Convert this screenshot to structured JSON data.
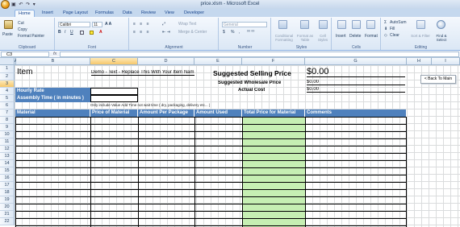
{
  "window": {
    "title": "price.xlsm - Microsoft Excel",
    "quick_access": "▣ ↶ ↷ ▾"
  },
  "ribbon_tabs": [
    "Home",
    "Insert",
    "Page Layout",
    "Formulas",
    "Data",
    "Review",
    "View",
    "Developer"
  ],
  "ribbon": {
    "clipboard": {
      "paste": "Paste",
      "cut": "Cut",
      "copy": "Copy",
      "format_painter": "Format Painter",
      "label": "Clipboard"
    },
    "font": {
      "name": "Calibri",
      "size": "11",
      "label": "Font"
    },
    "alignment": {
      "wrap": "Wrap Text",
      "merge": "Merge & Center",
      "label": "Alignment"
    },
    "number": {
      "format": "General",
      "currency": "$",
      "percent": "%",
      "comma": ",",
      "label": "Number"
    },
    "styles": {
      "conditional": "Conditional Formatting",
      "as_table": "Format as Table",
      "cell_styles": "Cell Styles",
      "label": "Styles"
    },
    "cells": {
      "insert": "Insert",
      "delete": "Delete",
      "format": "Format",
      "label": "Cells"
    },
    "editing": {
      "autosum": "AutoSum",
      "fill": "Fill",
      "clear": "Clear",
      "sort": "Sort & Filter",
      "find": "Find & Select",
      "label": "Editing"
    }
  },
  "formula_bar": {
    "name_box": "C3",
    "fx": "fx",
    "formula": ""
  },
  "columns": [
    "A",
    "B",
    "C",
    "D",
    "E",
    "F",
    "G",
    "H",
    "I"
  ],
  "rows": [
    "1",
    "2",
    "3",
    "4",
    "5",
    "6",
    "7",
    "8",
    "9",
    "10",
    "11",
    "12",
    "13",
    "14",
    "15",
    "16",
    "17",
    "18",
    "19",
    "20",
    "21",
    "22"
  ],
  "sheet": {
    "item_label": "Item",
    "item_value": "Demo - Text - Replace This With Your Item Nam",
    "ssp_label": "Suggested Selling Price",
    "ssp_value": "$0.00",
    "swp_label": "Suggested Wholesale Price",
    "swp_value": "$0.00",
    "ac_label": "Actual Cost",
    "ac_value": "$0.00",
    "back_button": "< Back To Main",
    "hourly_rate": "Hourly Rate",
    "assembly_time": "Assembly Time ( in minutes )",
    "note": "Only include Value Add Time not wait time ( dry, packaging, delivery etc... )",
    "table_headers": [
      "Material",
      "Price of Material",
      "Amount Per Package",
      "Amount Used",
      "Total Price for Material",
      "Comments"
    ]
  },
  "colors": {
    "header_blue": "#4f81bd",
    "total_green": "#c6efb3",
    "ribbon_blue": "#dbe7f5"
  }
}
